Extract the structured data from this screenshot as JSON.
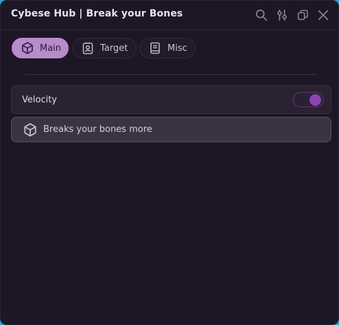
{
  "window": {
    "title": "Cybese Hub | Break your Bones"
  },
  "titlebar_icons": [
    "search-icon",
    "sliders-icon",
    "minimize-icon",
    "close-icon"
  ],
  "tabs": [
    {
      "label": "Main",
      "icon": "cube-icon",
      "active": true
    },
    {
      "label": "Target",
      "icon": "id-badge-icon",
      "active": false
    },
    {
      "label": "Misc",
      "icon": "book-icon",
      "active": false
    }
  ],
  "main": {
    "toggle": {
      "label": "Velocity",
      "enabled": true
    },
    "info_label": {
      "text": "Breaks your bones more",
      "icon": "cube-icon"
    }
  },
  "colors": {
    "window_bg": "#1d1624",
    "active_tab": "#b88bcb",
    "toggle_on": "#8b45b3",
    "desktop_bg": "#1fa3c9"
  }
}
